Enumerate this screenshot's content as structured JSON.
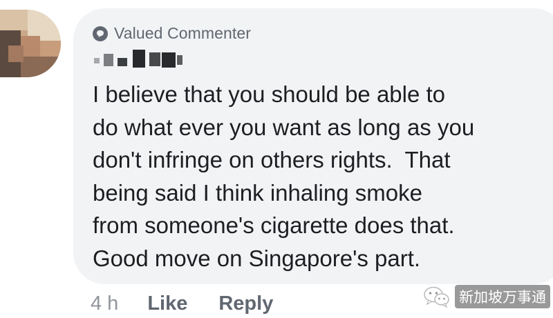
{
  "comment": {
    "badge": {
      "icon": "comment-bubble-icon",
      "label": "Valued Commenter"
    },
    "author_name": "",
    "text": "I believe that you should be able to\ndo what ever you want as long as you\ndon't infringe on others rights.  That\nbeing said I think inhaling smoke\nfrom someone's cigarette does that.\nGood move on Singapore's part.",
    "actions": {
      "timestamp": "4 h",
      "like_label": "Like",
      "reply_label": "Reply"
    }
  },
  "watermark": {
    "icon": "wechat-icon",
    "text": "新加坡万事通"
  },
  "colors": {
    "bubble_background": "#f2f3f5",
    "text": "#1c1e21",
    "secondary_text": "#606770",
    "timestamp_text": "#90949c"
  }
}
